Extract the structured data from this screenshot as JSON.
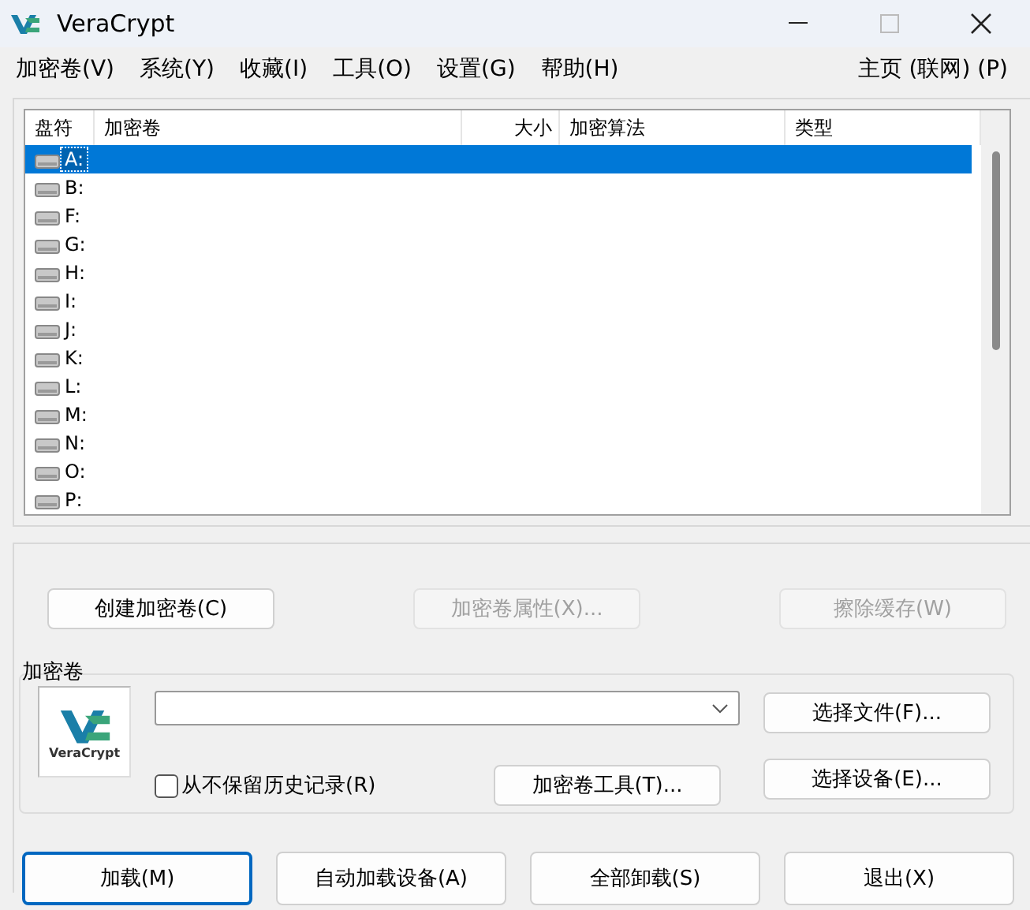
{
  "window": {
    "title": "VeraCrypt"
  },
  "menu": [
    {
      "label": "加密卷(V)"
    },
    {
      "label": "系统(Y)"
    },
    {
      "label": "收藏(I)"
    },
    {
      "label": "工具(O)"
    },
    {
      "label": "设置(G)"
    },
    {
      "label": "帮助(H)"
    }
  ],
  "menu_right": "主页 (联网) (P)",
  "drive_list": {
    "columns": [
      "盘符",
      "加密卷",
      "大小",
      "加密算法",
      "类型"
    ],
    "rows": [
      {
        "drive": "A:",
        "selected": true
      },
      {
        "drive": "B:",
        "selected": false
      },
      {
        "drive": "F:",
        "selected": false
      },
      {
        "drive": "G:",
        "selected": false
      },
      {
        "drive": "H:",
        "selected": false
      },
      {
        "drive": "I:",
        "selected": false
      },
      {
        "drive": "J:",
        "selected": false
      },
      {
        "drive": "K:",
        "selected": false
      },
      {
        "drive": "L:",
        "selected": false
      },
      {
        "drive": "M:",
        "selected": false
      },
      {
        "drive": "N:",
        "selected": false
      },
      {
        "drive": "O:",
        "selected": false
      },
      {
        "drive": "P:",
        "selected": false
      }
    ]
  },
  "volume_buttons": [
    {
      "label": "创建加密卷(C)",
      "disabled": false
    },
    {
      "label": "加密卷属性(X)...",
      "disabled": true
    },
    {
      "label": "擦除缓存(W)",
      "disabled": true
    }
  ],
  "volume_group": {
    "title": "加密卷",
    "logo_text": "VeraCrypt",
    "never_save_history": {
      "label": "从不保留历史记录(R)",
      "checked": false
    },
    "buttons": [
      {
        "label": "选择文件(F)...",
        "disabled": false
      },
      {
        "label": "加密卷工具(T)...",
        "disabled": false
      },
      {
        "label": "选择设备(E)...",
        "disabled": false
      }
    ]
  },
  "bottom_buttons": [
    {
      "label": "加载(M)",
      "default": true
    },
    {
      "label": "自动加载设备(A)",
      "default": false
    },
    {
      "label": "全部卸载(S)",
      "default": false
    },
    {
      "label": "退出(X)",
      "default": false
    }
  ]
}
